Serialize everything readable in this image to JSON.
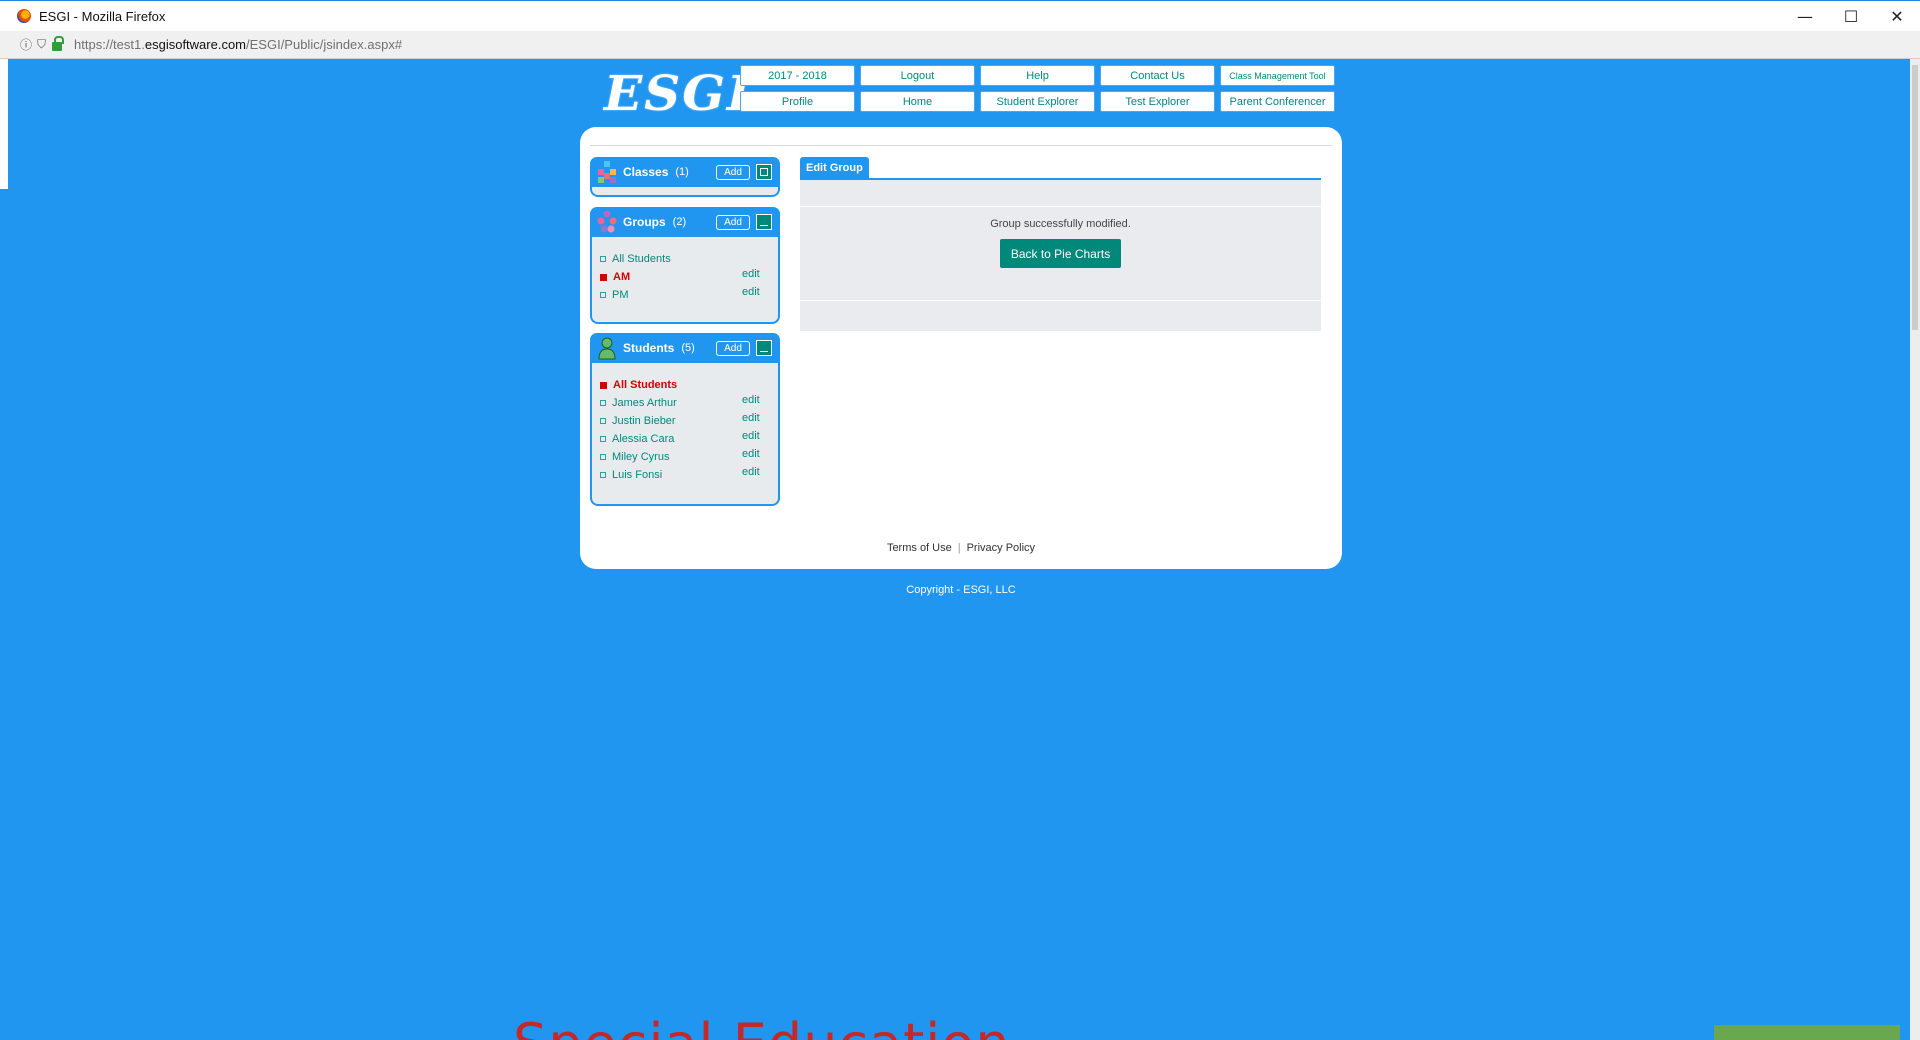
{
  "window": {
    "title": "ESGI - Mozilla Firefox",
    "minimize": "—",
    "maximize": "☐",
    "close": "✕"
  },
  "urlbar": {
    "url_prefix": "https://test1.",
    "url_host": "esgisoftware.com",
    "url_path": "/ESGI/Public/jsindex.aspx#"
  },
  "header": {
    "logo": "ESGI",
    "nav_top": [
      "2017 - 2018",
      "Logout",
      "Help",
      "Contact Us",
      "Class Management Tool"
    ],
    "nav_bottom": [
      "Profile",
      "Home",
      "Student Explorer",
      "Test Explorer",
      "Parent Conferencer"
    ]
  },
  "classes": {
    "title": "Classes",
    "count": "(1)",
    "add": "Add"
  },
  "groups": {
    "title": "Groups",
    "count": "(2)",
    "add": "Add",
    "items": [
      {
        "label": "All Students",
        "selected": false,
        "edit": ""
      },
      {
        "label": "AM",
        "selected": true,
        "edit": "edit"
      },
      {
        "label": "PM",
        "selected": false,
        "edit": "edit"
      }
    ]
  },
  "students": {
    "title": "Students",
    "count": "(5)",
    "add": "Add",
    "items": [
      {
        "label": "All Students",
        "selected": true,
        "edit": ""
      },
      {
        "label": "James Arthur",
        "selected": false,
        "edit": "edit"
      },
      {
        "label": "Justin Bieber",
        "selected": false,
        "edit": "edit"
      },
      {
        "label": "Alessia Cara",
        "selected": false,
        "edit": "edit"
      },
      {
        "label": "Miley Cyrus",
        "selected": false,
        "edit": "edit"
      },
      {
        "label": "Luis Fonsi",
        "selected": false,
        "edit": "edit"
      }
    ]
  },
  "edit_group": {
    "tab": "Edit Group",
    "message": "Group successfully modified.",
    "back_button": "Back to Pie Charts"
  },
  "footer": {
    "terms": "Terms of Use",
    "separator": "|",
    "privacy": "Privacy Policy",
    "copyright": "Copyright - ESGI, LLC"
  },
  "background_text": "Special Education",
  "colors": {
    "page_blue": "#2196f0",
    "teal": "#00897b",
    "selected_red": "#d50000"
  }
}
